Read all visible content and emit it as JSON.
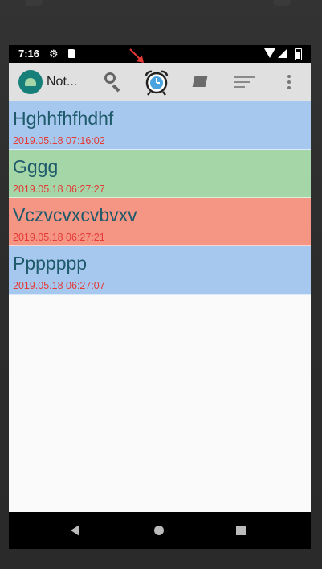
{
  "status_bar": {
    "time": "7:16"
  },
  "app_bar": {
    "title": "Not..."
  },
  "notes": [
    {
      "title": "Hghhfhfhdhf",
      "date": "2019.05.18 07:16:02",
      "color": "#a7c8ee"
    },
    {
      "title": "Gggg",
      "date": "2019.05.18 06:27:27",
      "color": "#a5d6a7"
    },
    {
      "title": "Vczvcvxcvbvxv",
      "date": "2019.05.18 06:27:21",
      "color": "#f59584"
    },
    {
      "title": "Ppppppp",
      "date": "2019.05.18 06:27:07",
      "color": "#a7c8ee"
    }
  ],
  "icons": {
    "app_logo": "android-icon",
    "search": "search-icon",
    "alarm": "alarm-clock-icon",
    "edit": "edit-icon",
    "sort": "sort-icon",
    "more": "more-vert-icon"
  }
}
